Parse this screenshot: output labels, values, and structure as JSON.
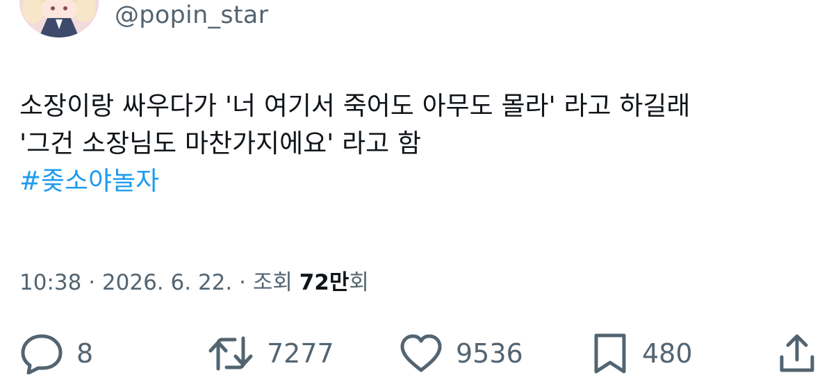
{
  "author": {
    "handle": "@popin_star"
  },
  "tweet": {
    "lines": [
      "소장이랑 싸우다가 '너 여기서 죽어도 아무도 몰라' 라고 하길래",
      "'그건 소장님도 마찬가지에요' 라고 함"
    ],
    "hashtag": "#좆소야놀자"
  },
  "meta": {
    "time": "10:38",
    "sep1": " · ",
    "date": "2026. 6. 22.",
    "sep2": " · ",
    "views_label": "조회 ",
    "views_count": "72만",
    "views_suffix": "회"
  },
  "actions": {
    "reply_count": "8",
    "retweet_count": "7277",
    "like_count": "9536",
    "bookmark_count": "480"
  },
  "icons": {
    "reply": "reply-bubble-icon",
    "retweet": "retweet-icon",
    "like": "heart-icon",
    "bookmark": "bookmark-icon",
    "share": "share-icon"
  },
  "colors": {
    "text": "#0f1419",
    "secondary": "#536471",
    "hashtag": "#1d9bf0"
  }
}
